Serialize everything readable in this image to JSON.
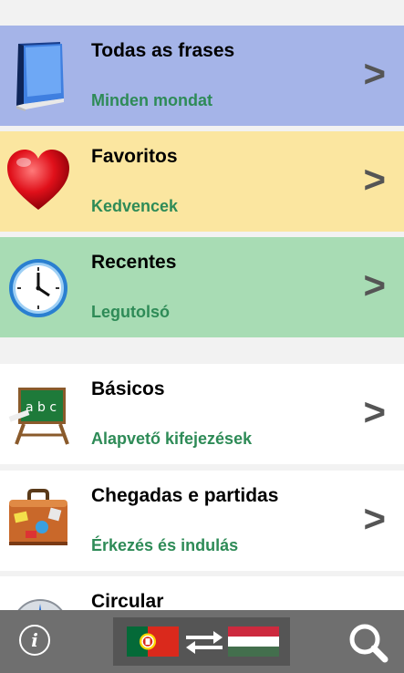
{
  "sections": [
    {
      "id": "all",
      "title": "Todas as frases",
      "subtitle": "Minden mondat",
      "icon": "book-icon",
      "bg": "#a5b4e8"
    },
    {
      "id": "favorites",
      "title": "Favoritos",
      "subtitle": "Kedvencek",
      "icon": "heart-icon",
      "bg": "#fbe6a0"
    },
    {
      "id": "recent",
      "title": "Recentes",
      "subtitle": "Legutolsó",
      "icon": "clock-icon",
      "bg": "#a8dcb4"
    }
  ],
  "categories": [
    {
      "id": "basics",
      "title": "Básicos",
      "subtitle": "Alapvető kifejezések",
      "icon": "chalkboard-icon",
      "bg": "#ffffff"
    },
    {
      "id": "arrivals",
      "title": "Chegadas e partidas",
      "subtitle": "Érkezés és indulás",
      "icon": "suitcase-icon",
      "bg": "#ffffff"
    },
    {
      "id": "circular",
      "title": "Circular",
      "subtitle": "",
      "icon": "compass-icon",
      "bg": "#ffffff"
    }
  ],
  "chevron": ">",
  "toolbar": {
    "info_label": "i",
    "info_icon": "info-icon",
    "language_switch_icon": "language-swap-icon",
    "source_flag": "portugal-flag-icon",
    "target_flag": "hungary-flag-icon",
    "search_icon": "search-icon"
  },
  "colors": {
    "subtitle": "#2e8b57",
    "toolbar": "#6f6f6f",
    "chevron": "#555555"
  }
}
